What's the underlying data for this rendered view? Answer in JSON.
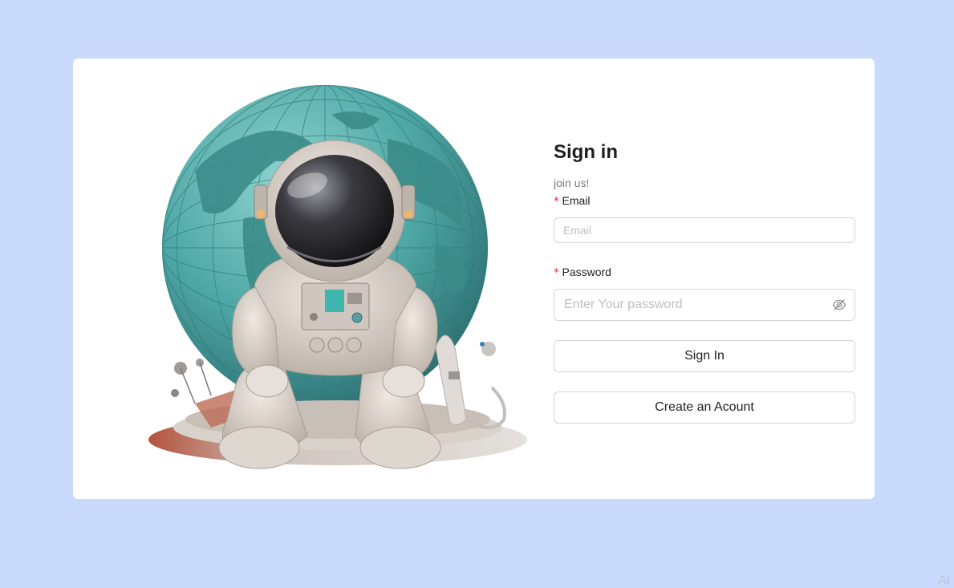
{
  "form": {
    "title": "Sign in",
    "subtitle": "join us!",
    "email_required": "*",
    "email_label": "Email",
    "email_placeholder": "Email",
    "password_required": "*",
    "password_label": "Password",
    "password_placeholder": "Enter Your password",
    "signin_label": "Sign In",
    "create_label": "Create an Acount"
  },
  "corner_text": "At",
  "icons": {
    "password_toggle": "eye-slash-icon"
  },
  "colors": {
    "background": "#c9dafd",
    "card": "#ffffff",
    "required": "#e0282e",
    "globe": "#4fa6a4",
    "suit": "#d6cec6",
    "visor": "#2a2a2e"
  }
}
